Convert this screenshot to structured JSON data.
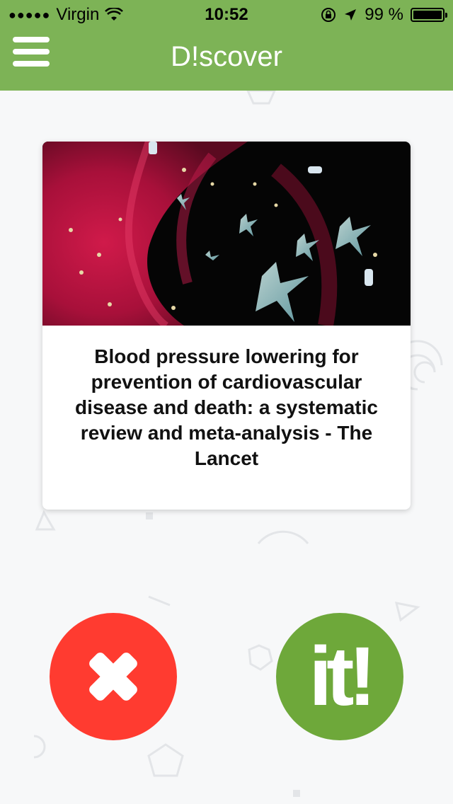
{
  "status_bar": {
    "signal": "●●●●●",
    "carrier": "Virgin",
    "time": "10:52",
    "battery": "99 %",
    "battery_level": 0.99
  },
  "header": {
    "title": "D!scover",
    "menu_icon": "hamburger-icon"
  },
  "card": {
    "image_alt": "Illustration of blood cells and platelets in a blood vessel",
    "title": "Blood pressure lowering for prevention of cardiovascular disease and death: a systematic review and meta-analysis - The Lancet"
  },
  "actions": {
    "reject_icon": "close-icon",
    "like_label": "it!"
  },
  "colors": {
    "header_bg": "#7db356",
    "reject_bg": "#ff3b30",
    "like_bg": "#6ea83a",
    "page_bg": "#f7f8f9"
  }
}
